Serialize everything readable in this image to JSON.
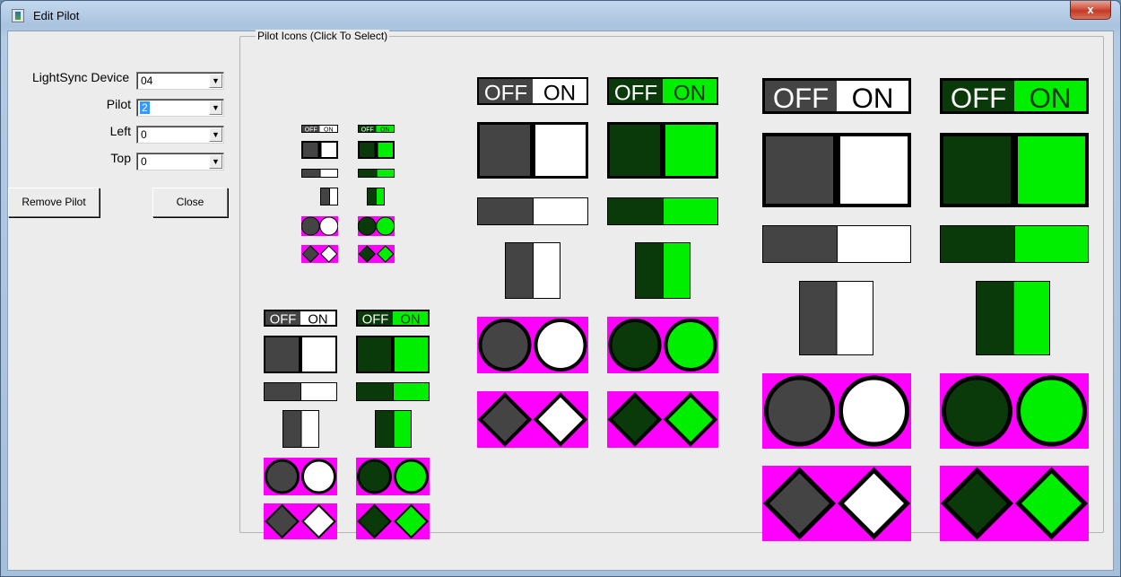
{
  "window": {
    "title": "Edit Pilot",
    "close_glyph": "x"
  },
  "form": {
    "device_label": "LightSync Device",
    "device_value": "04",
    "pilot_label": "Pilot",
    "pilot_value": "2",
    "left_label": "Left",
    "left_value": "0",
    "top_label": "Top",
    "top_value": "0",
    "remove_button": "Remove Pilot",
    "close_button": "Close"
  },
  "group": {
    "title": "Pilot Icons (Click To Select)"
  },
  "toggle_text": {
    "off": "OFF",
    "on": "ON"
  },
  "colors": {
    "gray_dark": "#444444",
    "gray_on": "#ffffff",
    "green_dark": "#0a3a0a",
    "green_on": "#00ee00",
    "magenta": "#ff00ff"
  },
  "icon_styles": [
    "toggle-text",
    "square",
    "bar",
    "vertical",
    "circles",
    "diamonds"
  ],
  "icon_themes": [
    "gray",
    "green"
  ],
  "icon_sizes": [
    "tiny",
    "small",
    "medium",
    "large"
  ]
}
